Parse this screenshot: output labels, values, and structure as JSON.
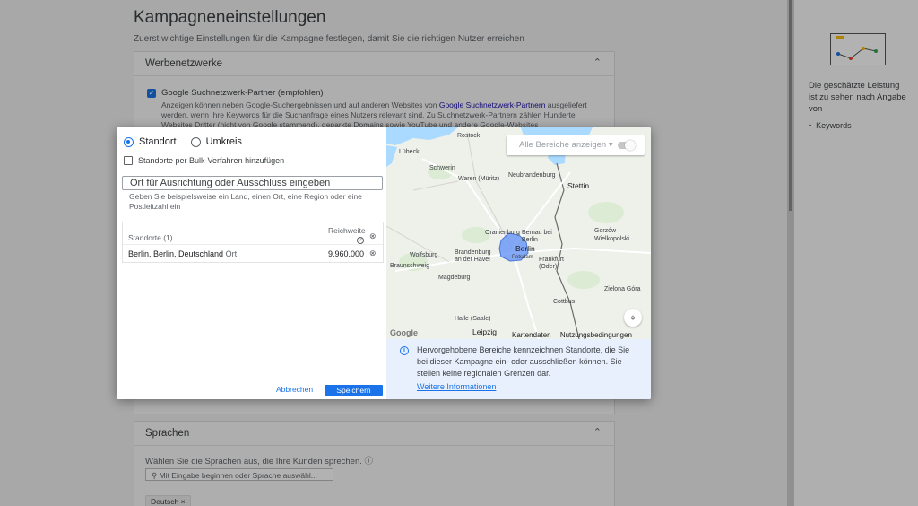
{
  "page": {
    "title": "Kampagneneinstellungen",
    "subtitle": "Zuerst wichtige Einstellungen für die Kampagne festlegen, damit Sie die richtigen Nutzer erreichen"
  },
  "ad_networks": {
    "title": "Werbenetzwerke",
    "checkbox_label": "Google Suchnetzwerk-Partner (empfohlen)",
    "desc_before": "Anzeigen können neben Google-Suchergebnissen und auf anderen Websites von ",
    "desc_link": "Google Suchnetzwerk-Partnern",
    "desc_after": " ausgeliefert werden, wenn Ihre Keywords für die Suchanfrage eines Nutzers relevant sind. Zu Suchnetzwerk-Partnern zählen Hunderte Websites Dritter (nicht von Google stammend), geparkte Domains sowie YouTube und andere Google-Websites"
  },
  "languages": {
    "title": "Sprachen",
    "desc": "Wählen Sie die Sprachen aus, die Ihre Kunden sprechen.",
    "search_placeholder": "Mit Eingabe beginnen oder Sprache auswähl...",
    "chip": "Deutsch"
  },
  "right_panel": {
    "text": "Die geschätzte Leistung ist zu sehen nach Angabe von",
    "bullet": "Keywords"
  },
  "dialog": {
    "radio_location": "Standort",
    "radio_radius": "Umkreis",
    "bulk_label": "Standorte per Bulk-Verfahren hinzufügen",
    "input_placeholder": "Ort für Ausrichtung oder Ausschluss eingeben",
    "input_hint": "Geben Sie beispielsweise ein Land, einen Ort, eine Region oder eine Postleitzahl ein",
    "table_header": "Standorte (1)",
    "reach_header": "Reichweite",
    "location_name": "Berlin, Berlin, Deutschland",
    "location_type": "Ort",
    "location_reach": "9.960.000",
    "cancel": "Abbrechen",
    "save": "Speichern"
  },
  "map": {
    "toggle_label": "Alle Bereiche anzeigen",
    "footer_data": "Kartendaten",
    "footer_terms": "Nutzungsbedingungen",
    "google": "Google",
    "labels": {
      "rostock": "Rostock",
      "lubeck": "Lübeck",
      "schwerin": "Schwerin",
      "waren": "Waren (Müritz)",
      "neubrandenburg": "Neubrandenburg",
      "stettin": "Stettin",
      "oranienburg": "Oranienburg",
      "bernau": "Bernau bei Berlin",
      "gorzow": "Gorzów Wielkopolski",
      "berlin": "Berlin",
      "wolfsburg": "Wolfsburg",
      "brandenburg": "Brandenburg an der Havel",
      "potsdam": "Potsdam",
      "frankfurt": "Frankfurt (Oder)",
      "braunschweig": "Braunschweig",
      "magdeburg": "Magdeburg",
      "zielona": "Zielona Góra",
      "cottbus": "Cottbus",
      "halle": "Halle (Saale)",
      "leipzig": "Leipzig"
    }
  },
  "info": {
    "text": "Hervorgehobene Bereiche kennzeichnen Standorte, die Sie bei dieser Kampagne ein- oder ausschließen können. Sie stellen keine regionalen Grenzen dar.",
    "link": "Weitere Informationen"
  },
  "colors": {
    "accent": "#1a73e8",
    "highlight_area": "#5c8df6",
    "info_bg": "#e8f0fe"
  }
}
